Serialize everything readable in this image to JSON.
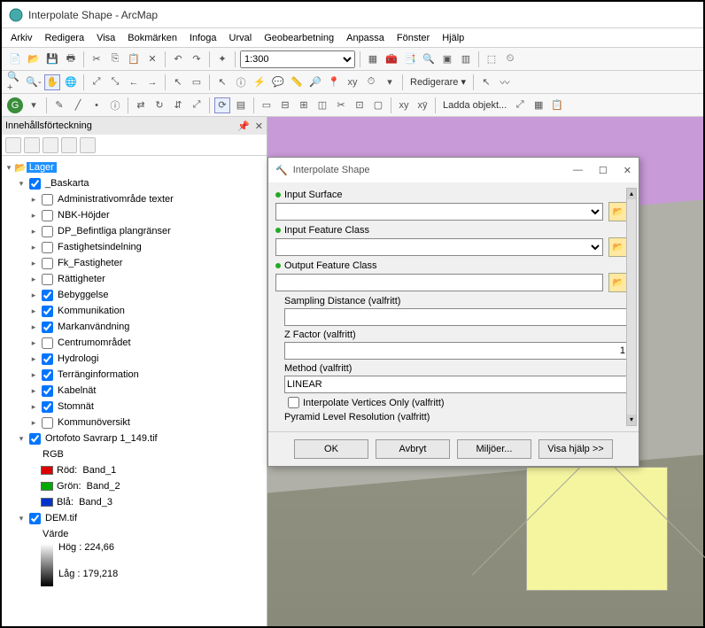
{
  "window": {
    "title": "Interpolate Shape - ArcMap"
  },
  "menu": [
    "Arkiv",
    "Redigera",
    "Visa",
    "Bokmärken",
    "Infoga",
    "Urval",
    "Geobearbetning",
    "Anpassa",
    "Fönster",
    "Hjälp"
  ],
  "toolbar1": {
    "scale": "1:300",
    "editor_label": "Redigerare ▾",
    "load_label": "Ladda objekt..."
  },
  "toc": {
    "title": "Innehållsförteckning",
    "root": "Lager",
    "baskarta": "_Baskarta",
    "items": [
      {
        "label": "Administrativområde texter",
        "checked": false
      },
      {
        "label": "NBK-Höjder",
        "checked": false
      },
      {
        "label": "DP_Befintliga plangränser",
        "checked": false
      },
      {
        "label": "Fastighetsindelning",
        "checked": false
      },
      {
        "label": "Fk_Fastigheter",
        "checked": false
      },
      {
        "label": "Rättigheter",
        "checked": false
      },
      {
        "label": "Bebyggelse",
        "checked": true
      },
      {
        "label": "Kommunikation",
        "checked": true
      },
      {
        "label": "Markanvändning",
        "checked": true
      },
      {
        "label": "Centrumområdet",
        "checked": false
      },
      {
        "label": "Hydrologi",
        "checked": true
      },
      {
        "label": "Terränginformation",
        "checked": true
      },
      {
        "label": "Kabelnät",
        "checked": true
      },
      {
        "label": "Stomnät",
        "checked": true
      },
      {
        "label": "Kommunöversikt",
        "checked": false
      }
    ],
    "ortofoto": {
      "label": "Ortofoto Savrarp 1_149.tif",
      "rgb": "RGB",
      "r": "Röd:",
      "g": "Grön:",
      "b": "Blå:",
      "b1": "Band_1",
      "b2": "Band_2",
      "b3": "Band_3"
    },
    "dem": {
      "label": "DEM.tif",
      "value": "Värde",
      "high": "Hög : 224,66",
      "low": "Låg : 179,218"
    }
  },
  "dialog": {
    "title": "Interpolate Shape",
    "input_surface": "Input Surface",
    "input_feature": "Input Feature Class",
    "output_feature": "Output Feature Class",
    "sampling": "Sampling Distance (valfritt)",
    "zfactor": "Z Factor (valfritt)",
    "zvalue": "1",
    "method": "Method (valfritt)",
    "method_value": "LINEAR",
    "vertices_only": "Interpolate Vertices Only (valfritt)",
    "pyramid": "Pyramid Level Resolution (valfritt)",
    "ok": "OK",
    "cancel": "Avbryt",
    "env": "Miljöer...",
    "help": "Visa hjälp >>"
  }
}
